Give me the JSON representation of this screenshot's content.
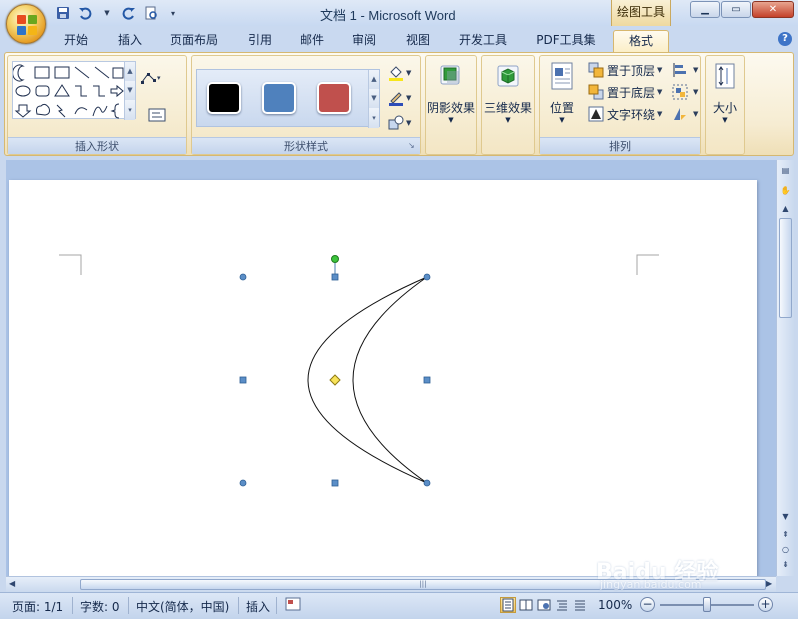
{
  "window": {
    "title": "文档 1 - Microsoft Word",
    "context_tab_group": "绘图工具"
  },
  "tabs": [
    {
      "label": "开始"
    },
    {
      "label": "插入"
    },
    {
      "label": "页面布局"
    },
    {
      "label": "引用"
    },
    {
      "label": "邮件"
    },
    {
      "label": "审阅"
    },
    {
      "label": "视图"
    },
    {
      "label": "开发工具"
    },
    {
      "label": "PDF工具集"
    },
    {
      "label": "格式",
      "active": true
    }
  ],
  "ribbon": {
    "insert_shapes": {
      "label": "插入形状"
    },
    "shape_styles": {
      "label": "形状样式",
      "swatches": [
        "#000000",
        "#4f81bd",
        "#c0504d"
      ]
    },
    "shadow": {
      "label": "阴影效果"
    },
    "threed": {
      "label": "三维效果"
    },
    "arrange": {
      "label": "排列",
      "position": "位置",
      "bring_front": "置于顶层",
      "send_back": "置于底层",
      "text_wrap": "文字环绕"
    },
    "size": {
      "label": "大小"
    }
  },
  "statusbar": {
    "page": "页面: 1/1",
    "words": "字数: 0",
    "language": "中文(简体，中国)",
    "mode": "插入",
    "zoom": "100%",
    "zoom_level": 1.0
  },
  "watermark": {
    "text": "Baidu 经验",
    "sub": "jingyan.baidu.com"
  }
}
